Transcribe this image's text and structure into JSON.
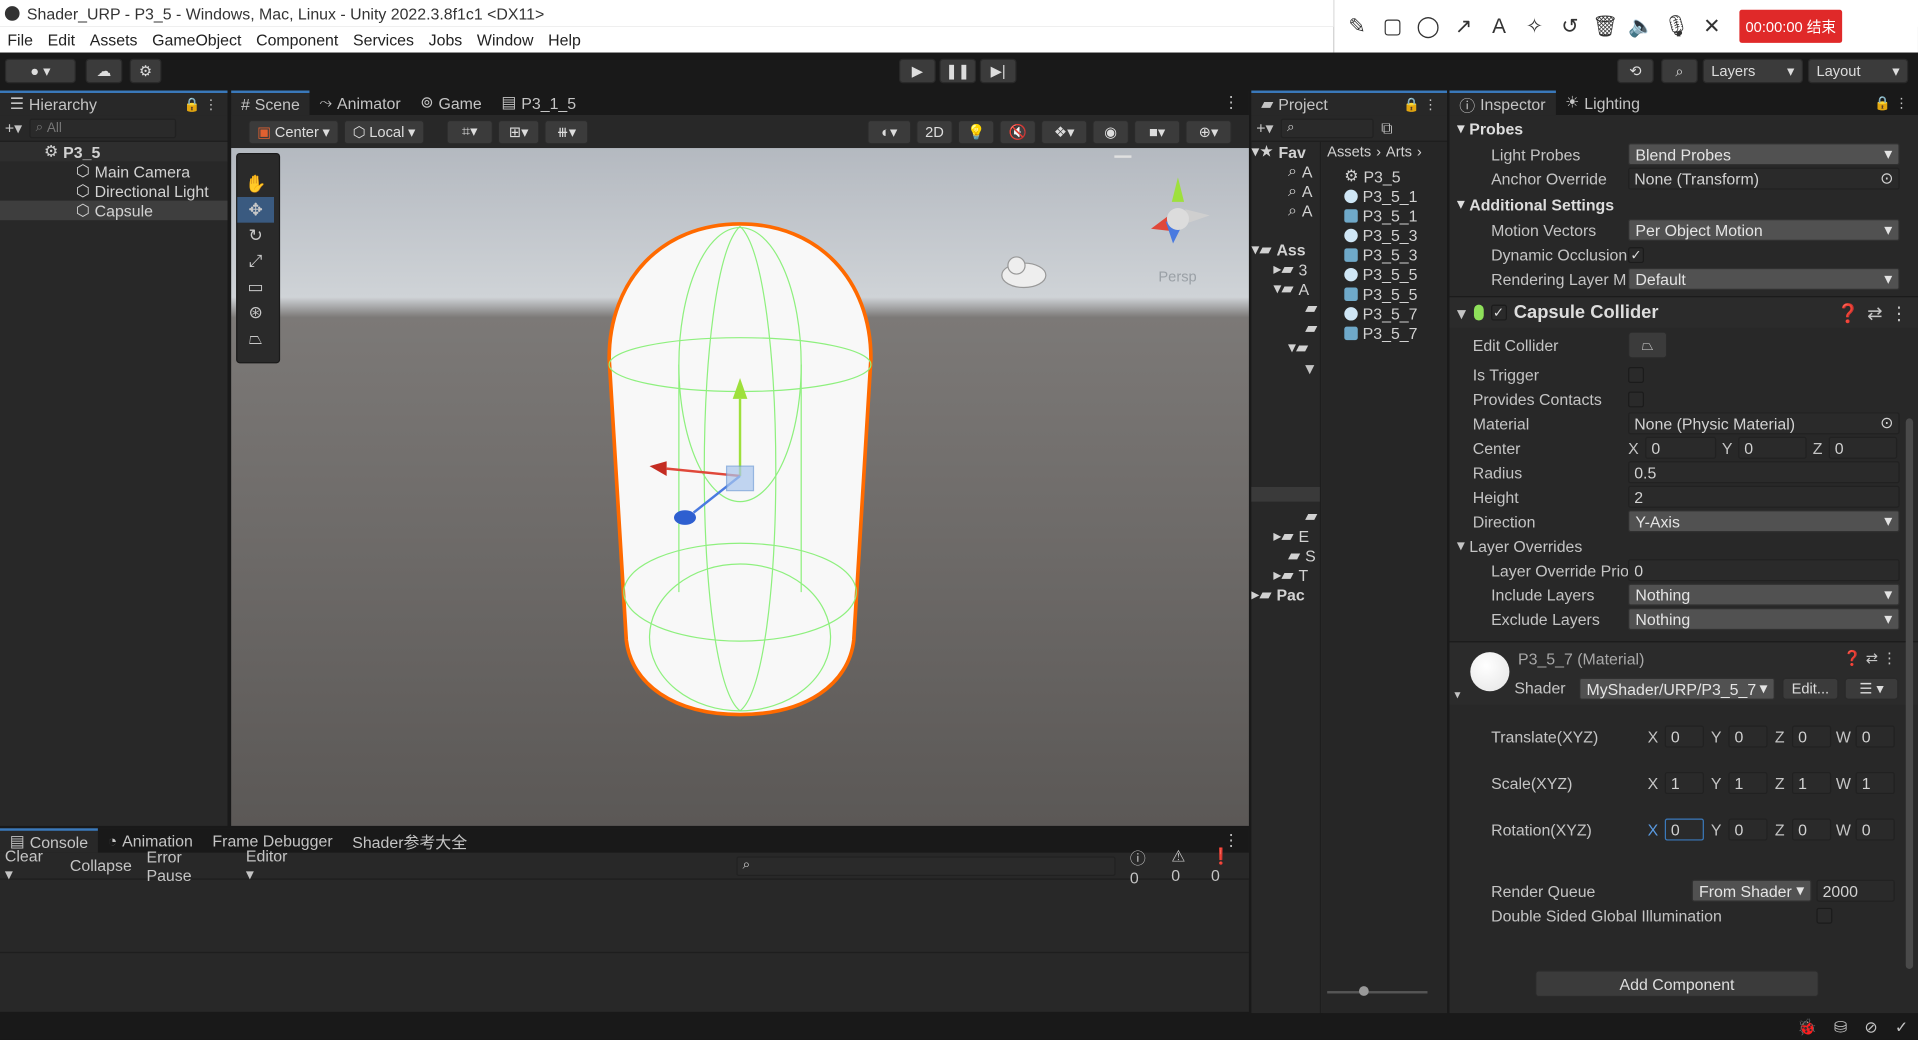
{
  "window": {
    "title": "Shader_URP - P3_5 - Windows, Mac, Linux - Unity 2022.3.8f1c1 <DX11>"
  },
  "menu": [
    "File",
    "Edit",
    "Assets",
    "GameObject",
    "Component",
    "Services",
    "Jobs",
    "Window",
    "Help"
  ],
  "recorder": {
    "icons": [
      "pencil-icon",
      "rectangle-icon",
      "circle-icon",
      "arrow-icon",
      "text-icon",
      "magic-wand-icon",
      "undo-icon",
      "trash-icon",
      "speaker-icon",
      "microphone-icon",
      "close-icon"
    ],
    "time": "00:00:00 结束"
  },
  "toolbar": {
    "account_symbol": "🅐",
    "layers": "Layers",
    "layout": "Layout"
  },
  "hierarchy": {
    "tab": "Hierarchy",
    "search": "All",
    "scene": "P3_5",
    "items": [
      "Main Camera",
      "Directional Light",
      "Capsule"
    ]
  },
  "scene_tabs": [
    "Scene",
    "Animator",
    "Game",
    "P3_1_5"
  ],
  "scene": {
    "center": "Center",
    "local": "Local",
    "mode2d": "2D",
    "persp": "Persp"
  },
  "colors": {
    "accent": "#3a79bb",
    "selection_outline": "#ff6a00",
    "collider": "#8ef07e",
    "bg_dark": "#191919",
    "panel": "#282828"
  },
  "console": {
    "tabs": [
      "Console",
      "Animation",
      "Frame Debugger",
      "Shader参考大全"
    ],
    "clear": "Clear",
    "collapse": "Collapse",
    "error_pause": "Error Pause",
    "editor": "Editor",
    "counts": [
      "0",
      "0",
      "0"
    ]
  },
  "project": {
    "tab": "Project",
    "fav": "Fav",
    "ass": "Ass",
    "pac": "Pac",
    "fav_items": [
      "A",
      "A",
      "A"
    ],
    "tree": [
      "3",
      "A",
      "E",
      "S",
      "T"
    ],
    "breadcrumb": [
      "Assets",
      "Arts"
    ],
    "files": [
      {
        "name": "P3_5",
        "type": "unity"
      },
      {
        "name": "P3_5_1",
        "type": "mat"
      },
      {
        "name": "P3_5_1",
        "type": "shader"
      },
      {
        "name": "P3_5_3",
        "type": "shader"
      },
      {
        "name": "P3_5_3",
        "type": "shader"
      },
      {
        "name": "P3_5_5",
        "type": "mat"
      },
      {
        "name": "P3_5_5",
        "type": "shader"
      },
      {
        "name": "P3_5_7",
        "type": "mat"
      },
      {
        "name": "P3_5_7",
        "type": "shader"
      }
    ]
  },
  "inspector": {
    "tabs": [
      "Inspector",
      "Lighting"
    ],
    "probes": {
      "title": "Probes",
      "light_probes_label": "Light Probes",
      "light_probes_value": "Blend Probes",
      "anchor_label": "Anchor Override",
      "anchor_value": "None (Transform)"
    },
    "additional": {
      "title": "Additional Settings",
      "motion_label": "Motion Vectors",
      "motion_value": "Per Object Motion",
      "dyn_label": "Dynamic Occlusion",
      "dyn_checked": "✓",
      "rlm_label": "Rendering Layer M",
      "rlm_value": "Default"
    },
    "collider": {
      "title": "Capsule Collider",
      "enabled": "✓",
      "edit_label": "Edit Collider",
      "trigger_label": "Is Trigger",
      "contacts_label": "Provides Contacts",
      "material_label": "Material",
      "material_value": "None (Physic Material)",
      "center_label": "Center",
      "center": [
        "0",
        "0",
        "0"
      ],
      "radius_label": "Radius",
      "radius": "0.5",
      "height_label": "Height",
      "height": "2",
      "direction_label": "Direction",
      "direction": "Y-Axis",
      "overrides_label": "Layer Overrides",
      "priority_label": "Layer Override Priority",
      "priority": "0",
      "include_label": "Include Layers",
      "include": "Nothing",
      "exclude_label": "Exclude Layers",
      "exclude": "Nothing"
    },
    "material": {
      "name": "P3_5_7 (Material)",
      "shader_label": "Shader",
      "shader": "MyShader/URP/P3_5_7",
      "edit": "Edit...",
      "translate_label": "Translate(XYZ)",
      "translate": [
        "0",
        "0",
        "0",
        "0"
      ],
      "scale_label": "Scale(XYZ)",
      "scale": [
        "1",
        "1",
        "1",
        "1"
      ],
      "rotation_label": "Rotation(XYZ)",
      "rotation": [
        "0",
        "0",
        "0",
        "0"
      ],
      "queue_label": "Render Queue",
      "queue_mode": "From Shader",
      "queue": "2000",
      "dsgi_label": "Double Sided Global Illumination"
    },
    "axes": [
      "X",
      "Y",
      "Z",
      "W"
    ],
    "add_component": "Add Component"
  }
}
